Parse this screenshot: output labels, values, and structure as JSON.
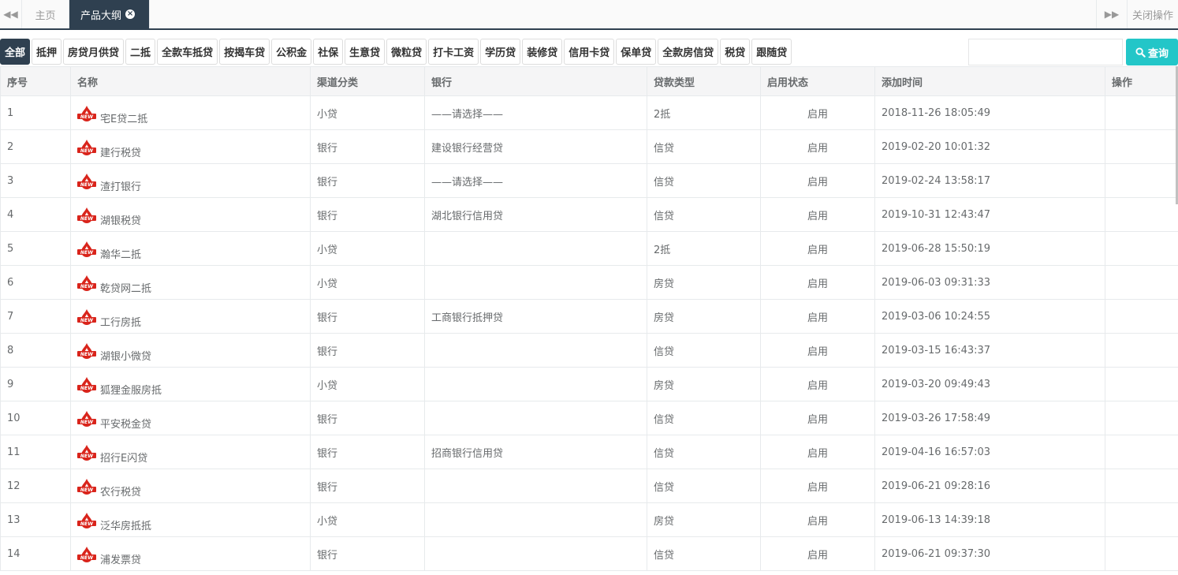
{
  "tabs": {
    "home_label": "主页",
    "active_label": "产品大纲",
    "close_ops_label": "关闭操作"
  },
  "filters": [
    "全部",
    "抵押",
    "房贷月供贷",
    "二抵",
    "全款车抵贷",
    "按揭车贷",
    "公积金",
    "社保",
    "生意贷",
    "微粒贷",
    "打卡工资",
    "学历贷",
    "装修贷",
    "信用卡贷",
    "保单贷",
    "全款房信贷",
    "税贷",
    "跟随贷"
  ],
  "search": {
    "placeholder": "",
    "button_label": "查询"
  },
  "table": {
    "headers": [
      "序号",
      "名称",
      "渠道分类",
      "银行",
      "贷款类型",
      "启用状态",
      "添加时间",
      "操作"
    ],
    "rows": [
      {
        "no": "1",
        "name": "宅E贷二抵",
        "channel": "小贷",
        "bank": "——请选择——",
        "type": "2抵",
        "status": "启用",
        "time": "2018-11-26 18:05:49"
      },
      {
        "no": "2",
        "name": "建行税贷",
        "channel": "银行",
        "bank": "建设银行经营贷",
        "type": "信贷",
        "status": "启用",
        "time": "2019-02-20 10:01:32"
      },
      {
        "no": "3",
        "name": "渣打银行",
        "channel": "银行",
        "bank": "——请选择——",
        "type": "信贷",
        "status": "启用",
        "time": "2019-02-24 13:58:17"
      },
      {
        "no": "4",
        "name": "湖银税贷",
        "channel": "银行",
        "bank": "湖北银行信用贷",
        "type": "信贷",
        "status": "启用",
        "time": "2019-10-31 12:43:47"
      },
      {
        "no": "5",
        "name": "瀚华二抵",
        "channel": "小贷",
        "bank": "",
        "type": "2抵",
        "status": "启用",
        "time": "2019-06-28 15:50:19"
      },
      {
        "no": "6",
        "name": "乾贷网二抵",
        "channel": "小贷",
        "bank": "",
        "type": "房贷",
        "status": "启用",
        "time": "2019-06-03 09:31:33"
      },
      {
        "no": "7",
        "name": "工行房抵",
        "channel": "银行",
        "bank": "工商银行抵押贷",
        "type": "房贷",
        "status": "启用",
        "time": "2019-03-06 10:24:55"
      },
      {
        "no": "8",
        "name": "湖银小微贷",
        "channel": "银行",
        "bank": "",
        "type": "信贷",
        "status": "启用",
        "time": "2019-03-15 16:43:37"
      },
      {
        "no": "9",
        "name": "狐狸金服房抵",
        "channel": "小贷",
        "bank": "",
        "type": "房贷",
        "status": "启用",
        "time": "2019-03-20 09:49:43"
      },
      {
        "no": "10",
        "name": "平安税金贷",
        "channel": "银行",
        "bank": "",
        "type": "信贷",
        "status": "启用",
        "time": "2019-03-26 17:58:49"
      },
      {
        "no": "11",
        "name": "招行E闪贷",
        "channel": "银行",
        "bank": "招商银行信用贷",
        "type": "信贷",
        "status": "启用",
        "time": "2019-04-16 16:57:03"
      },
      {
        "no": "12",
        "name": "农行税贷",
        "channel": "银行",
        "bank": "",
        "type": "信贷",
        "status": "启用",
        "time": "2019-06-21 09:28:16"
      },
      {
        "no": "13",
        "name": "泛华房抵抵",
        "channel": "小贷",
        "bank": "",
        "type": "房贷",
        "status": "启用",
        "time": "2019-06-13 14:39:18"
      },
      {
        "no": "14",
        "name": "浦发票贷",
        "channel": "银行",
        "bank": "",
        "type": "信贷",
        "status": "启用",
        "time": "2019-06-21 09:37:30"
      }
    ]
  },
  "icons": {
    "row_badge": "new-badge-icon",
    "new_badge_text": "NEW",
    "badge_color": "#d9241b"
  },
  "colors": {
    "dark": "#2f4050",
    "accent": "#23c6c8"
  }
}
